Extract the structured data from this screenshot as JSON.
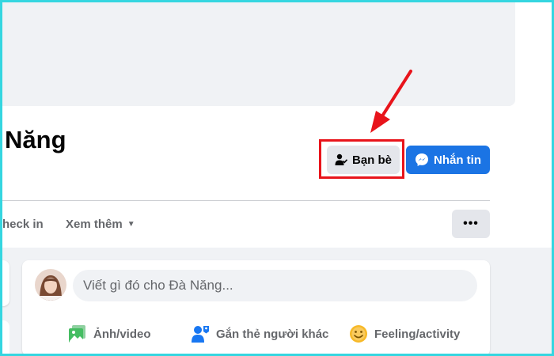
{
  "profile": {
    "name": "Năng"
  },
  "actions": {
    "friends_label": "Bạn bè",
    "message_label": "Nhắn tin",
    "more_options_label": "•••"
  },
  "tabs": {
    "checkin_label": "heck in",
    "more_label": "Xem thêm"
  },
  "composer": {
    "placeholder": "Viết gì đó cho Đà Năng...",
    "photo_label": "Ảnh/video",
    "tag_label": "Gắn thẻ người khác",
    "feeling_label": "Feeling/activity"
  },
  "colors": {
    "primary_blue": "#1b74e4",
    "highlight_red": "#e8141b",
    "frame_cyan": "#35d6e0",
    "button_gray": "#e4e6eb"
  },
  "icons": {
    "friends": "user-check-icon",
    "messenger": "messenger-icon",
    "caret": "caret-down-icon",
    "photo": "photo-icon",
    "tag": "tag-people-icon",
    "feeling": "smiley-icon"
  }
}
